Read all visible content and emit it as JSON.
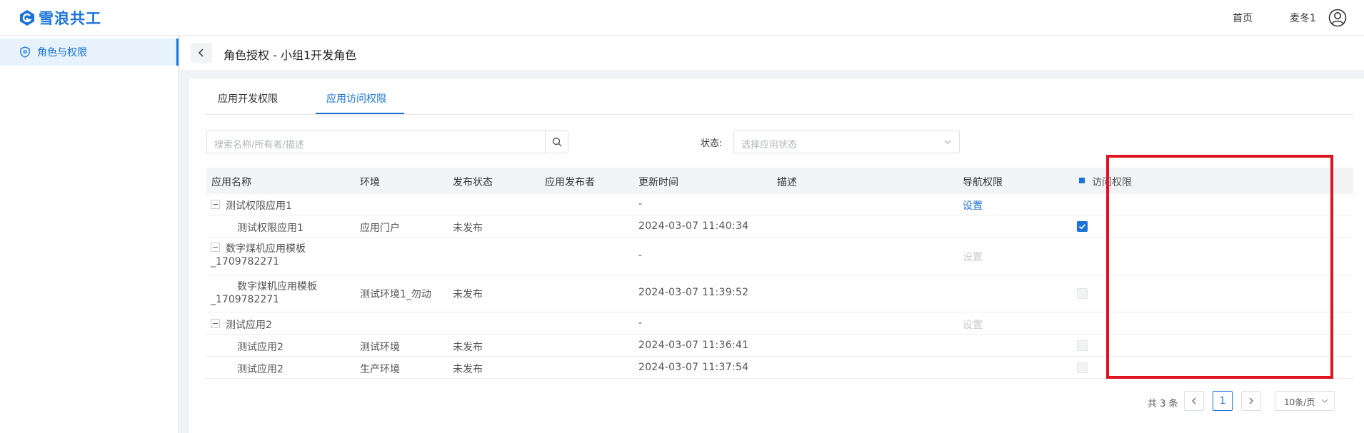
{
  "app": {
    "name": "雪浪共工",
    "brand_color": "#1a73d9"
  },
  "topnav": {
    "home": "首页",
    "user": "麦冬1"
  },
  "sidebar": {
    "items": [
      {
        "label": "角色与权限"
      }
    ]
  },
  "page": {
    "title": "角色授权 - 小组1开发角色"
  },
  "tabs": [
    {
      "label": "应用开发权限",
      "active": false
    },
    {
      "label": "应用访问权限",
      "active": true
    }
  ],
  "filters": {
    "search_placeholder": "搜索名称/所有者/描述",
    "status_label": "状态:",
    "status_placeholder": "选择应用状态"
  },
  "table": {
    "columns": [
      "应用名称",
      "环境",
      "发布状态",
      "应用发布者",
      "更新时间",
      "描述",
      "导航权限",
      "访问权限"
    ],
    "rows": [
      {
        "name": "测试权限应用1",
        "group": true,
        "env": "",
        "status": "",
        "publisher": "",
        "updated": "-",
        "nav": "设置",
        "nav_enabled": true,
        "access": null
      },
      {
        "name": "测试权限应用1",
        "group": false,
        "env": "应用门户",
        "status": "未发布",
        "publisher": "",
        "updated": "2024-03-07 11:40:34",
        "nav": "",
        "nav_enabled": false,
        "access": "checked"
      },
      {
        "name_line1": "数字煤机应用模板",
        "name_line2": "_1709782271",
        "group": true,
        "env": "",
        "status": "",
        "publisher": "",
        "updated": "-",
        "nav": "设置",
        "nav_enabled": false,
        "access": null
      },
      {
        "name_line1": "数字煤机应用模板",
        "name_line2": "_1709782271",
        "group": false,
        "env": "测试环境1_勿动",
        "status": "未发布",
        "publisher": "",
        "updated": "2024-03-07 11:39:52",
        "nav": "",
        "nav_enabled": false,
        "access": "disabled"
      },
      {
        "name": "测试应用2",
        "group": true,
        "env": "",
        "status": "",
        "publisher": "",
        "updated": "-",
        "nav": "设置",
        "nav_enabled": false,
        "access": null
      },
      {
        "name": "测试应用2",
        "group": false,
        "env": "测试环境",
        "status": "未发布",
        "publisher": "",
        "updated": "2024-03-07 11:36:41",
        "nav": "",
        "nav_enabled": false,
        "access": "disabled"
      },
      {
        "name": "测试应用2",
        "group": false,
        "env": "生产环境",
        "status": "未发布",
        "publisher": "",
        "updated": "2024-03-07 11:37:54",
        "nav": "",
        "nav_enabled": false,
        "access": "disabled"
      }
    ]
  },
  "pagination": {
    "total": "共 3 条",
    "current_page": "1",
    "page_size": "10条/页"
  },
  "highlight_color": "#e0141e"
}
